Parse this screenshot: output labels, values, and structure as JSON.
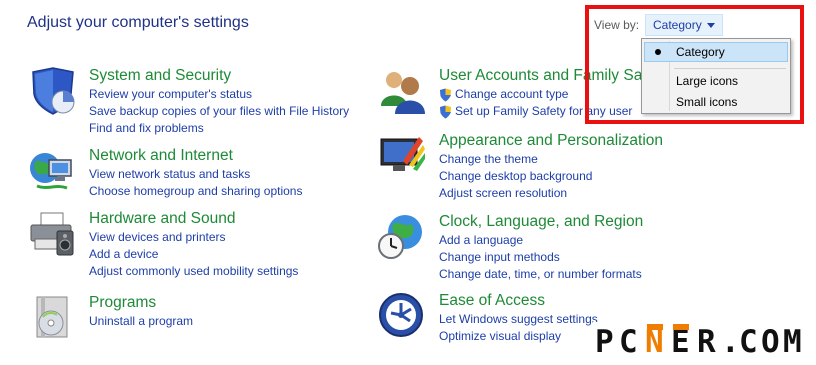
{
  "page_title": "Adjust your computer's settings",
  "view_by": {
    "label": "View by:",
    "selected": "Category",
    "options": [
      "Category",
      "Large icons",
      "Small icons"
    ]
  },
  "categories": [
    {
      "title": "System and Security",
      "icon": "system-security-icon",
      "links": [
        "Review your computer's status",
        "Save backup copies of your files with File History",
        "Find and fix problems"
      ]
    },
    {
      "title": "Network and Internet",
      "icon": "network-internet-icon",
      "links": [
        "View network status and tasks",
        "Choose homegroup and sharing options"
      ]
    },
    {
      "title": "Hardware and Sound",
      "icon": "hardware-sound-icon",
      "links": [
        "View devices and printers",
        "Add a device",
        "Adjust commonly used mobility settings"
      ]
    },
    {
      "title": "Programs",
      "icon": "programs-icon",
      "links": [
        "Uninstall a program"
      ]
    },
    {
      "title": "User Accounts and Family Safety",
      "icon": "user-accounts-icon",
      "links": [
        "Change account type",
        "Set up Family Safety for any user"
      ]
    },
    {
      "title": "Appearance and Personalization",
      "icon": "appearance-icon",
      "links": [
        "Change the theme",
        "Change desktop background",
        "Adjust screen resolution"
      ]
    },
    {
      "title": "Clock, Language, and Region",
      "icon": "clock-globe-icon",
      "links": [
        "Add a language",
        "Change input methods",
        "Change date, time, or number formats"
      ]
    },
    {
      "title": "Ease of Access",
      "icon": "ease-of-access-icon",
      "links": [
        "Let Windows suggest settings",
        "Optimize visual display"
      ]
    }
  ],
  "watermark": "PCNER.COM",
  "colors": {
    "title_green": "#1e8a37",
    "link_blue": "#1e3ea8",
    "highlight_red": "#e81010"
  }
}
